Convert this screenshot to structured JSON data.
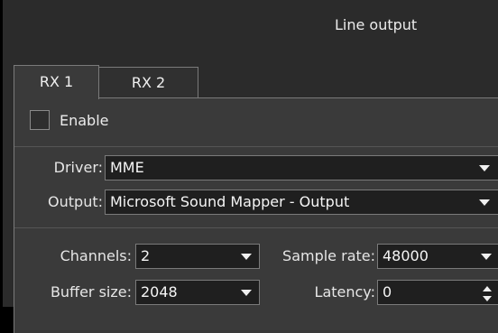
{
  "group": {
    "title": "Line output"
  },
  "tabs": [
    {
      "label": "RX 1",
      "active": true
    },
    {
      "label": "RX 2",
      "active": false
    }
  ],
  "enable": {
    "label": "Enable",
    "checked": false
  },
  "driver": {
    "label": "Driver:",
    "value": "MME"
  },
  "output": {
    "label": "Output:",
    "value": "Microsoft Sound Mapper - Output"
  },
  "channels": {
    "label": "Channels:",
    "value": "2"
  },
  "sample_rate": {
    "label": "Sample rate:",
    "value": "48000"
  },
  "buffer_size": {
    "label": "Buffer size:",
    "value": "2048"
  },
  "latency": {
    "label": "Latency:",
    "value": "0"
  },
  "icons": {
    "dropdown": "chevron-down-icon",
    "spin": "spin-arrows-icon"
  },
  "colors": {
    "background": "#2b2b2b",
    "panel": "#3a3a3a",
    "field": "#1f1f1f",
    "border": "#7a7a7a",
    "text": "#e8e8e8"
  }
}
